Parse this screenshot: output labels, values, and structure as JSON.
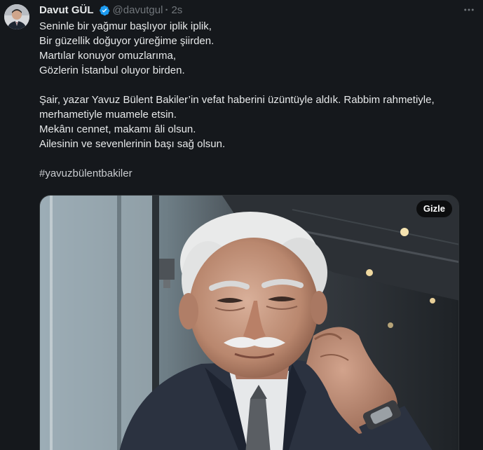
{
  "author": {
    "display_name": "Davut GÜL",
    "handle": "@davutgul",
    "separator": "·",
    "time": "2s",
    "verified_icon": "verified-badge-icon",
    "verified_color": "#1d9bf0"
  },
  "tweet": {
    "lines": [
      "Seninle bir yağmur başlıyor iplik iplik,",
      "Bir güzellik doğuyor yüreğime şiirden.",
      "Martılar konuyor omuzlarıma,",
      "Gözlerin İstanbul oluyor birden.",
      "",
      "Şair, yazar Yavuz Bülent Bakiler’in vefat haberini üzüntüyle aldık. Rabbim rahmetiyle,",
      "merhametiyle muamele etsin.",
      "Mekânı cennet, makamı âli olsun.",
      "Ailesinin ve sevenlerinin başı sağ olsun.",
      "",
      "#yavuzbülentbakiler"
    ]
  },
  "media": {
    "hide_label": "Gizle"
  },
  "icons": {
    "more": "more-options-icon"
  },
  "colors": {
    "background": "#15181c",
    "text": "#e7e9ea",
    "secondary_text": "#71767b"
  }
}
